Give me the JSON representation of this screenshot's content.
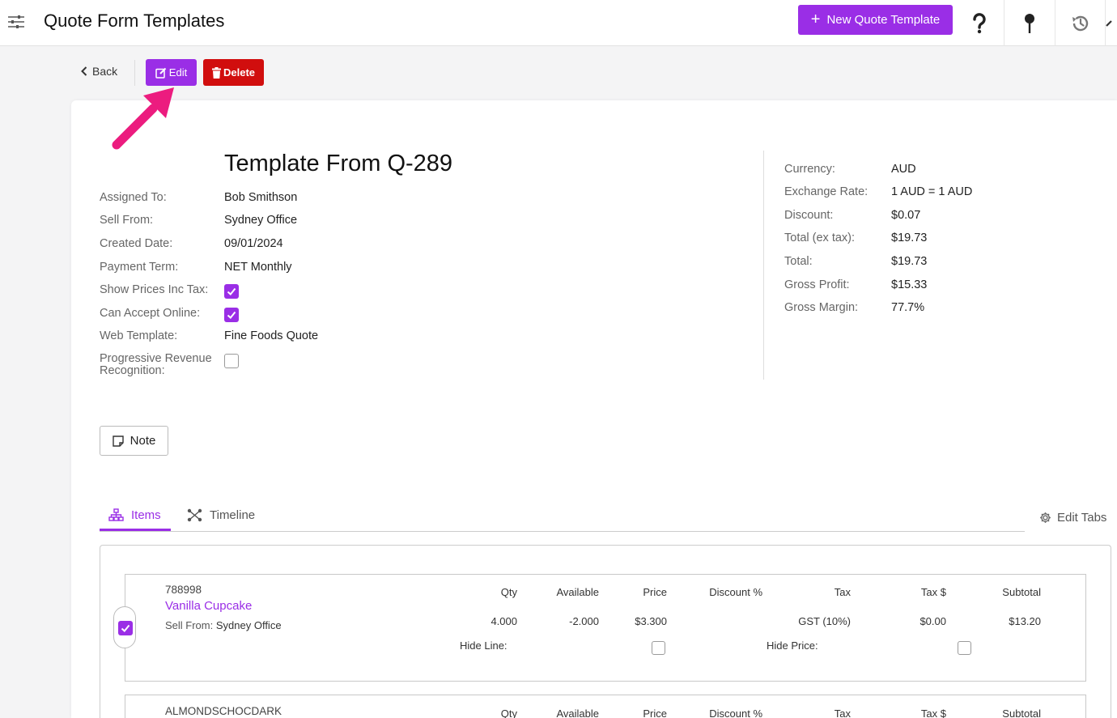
{
  "header": {
    "title": "Quote Form Templates",
    "new_button": "New Quote Template"
  },
  "actions": {
    "back": "Back",
    "edit": "Edit",
    "delete": "Delete"
  },
  "template": {
    "title": "Template From Q-289",
    "fields": [
      {
        "label": "Assigned To:",
        "value": "Bob Smithson"
      },
      {
        "label": "Sell From:",
        "value": "Sydney Office"
      },
      {
        "label": "Created Date:",
        "value": "09/01/2024"
      },
      {
        "label": "Payment Term:",
        "value": "NET Monthly"
      },
      {
        "label": "Show Prices Inc Tax:",
        "checked": true
      },
      {
        "label": "Can Accept Online:",
        "checked": true
      },
      {
        "label": "Web Template:",
        "value": "Fine Foods Quote"
      },
      {
        "label": "Progressive Revenue Recognition:",
        "checked": false
      }
    ]
  },
  "summary": [
    {
      "label": "Currency:",
      "value": "AUD"
    },
    {
      "label": "Exchange Rate:",
      "value": "1 AUD = 1 AUD"
    },
    {
      "label": "Discount:",
      "value": "$0.07"
    },
    {
      "label": "Total (ex tax):",
      "value": "$19.73"
    },
    {
      "label": "Total:",
      "value": "$19.73"
    },
    {
      "label": "Gross Profit:",
      "value": "$15.33"
    },
    {
      "label": "Gross Margin:",
      "value": "77.7%"
    }
  ],
  "note_button": "Note",
  "tabs": [
    {
      "label": "Items",
      "active": true
    },
    {
      "label": "Timeline",
      "active": false
    }
  ],
  "edit_tabs": "Edit Tabs",
  "columns": [
    "Qty",
    "Available",
    "Price",
    "Discount %",
    "Tax",
    "Tax $",
    "Subtotal"
  ],
  "items": [
    {
      "code": "788998",
      "name": "Vanilla Cupcake",
      "sell_from_label": "Sell From:",
      "sell_from": "Sydney Office",
      "qty": "4.000",
      "available": "-2.000",
      "price": "$3.300",
      "discount": "",
      "tax": "GST (10%)",
      "tax_amount": "$0.00",
      "subtotal": "$13.20",
      "hide_line_label": "Hide Line:",
      "hide_price_label": "Hide Price:",
      "selected": true
    },
    {
      "code": "ALMONDSCHOCDARK"
    }
  ],
  "colors": {
    "accent": "#9a2ee6",
    "danger": "#d10e0e",
    "arrow": "#ec1c7f"
  }
}
